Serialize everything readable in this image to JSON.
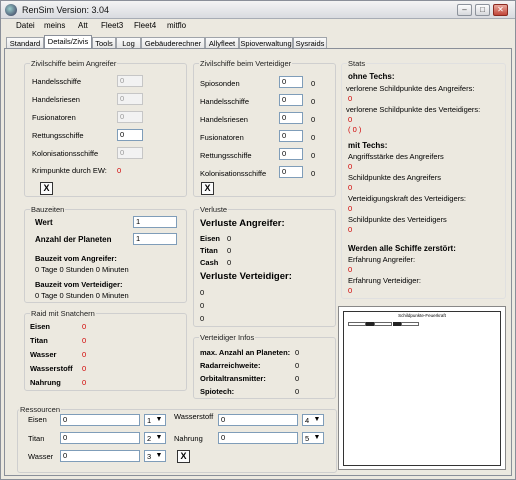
{
  "window": {
    "title": "RenSim Version: 3.04"
  },
  "menu": [
    "Datei",
    "meins",
    "Att",
    "Fleet3",
    "Fleet4",
    "mitflo"
  ],
  "tabs": [
    "Standard",
    "Details/Zivis",
    "Tools",
    "Log",
    "Gebäuderechner",
    "Allyfleet",
    "Spioverwaltung",
    "Sysraids"
  ],
  "attacker_civ": {
    "title": "Zivilschiffe beim Angreifer",
    "rows": [
      {
        "label": "Handelsschiffe",
        "value": "0"
      },
      {
        "label": "Handelsriesen",
        "value": "0"
      },
      {
        "label": "Fusionatoren",
        "value": "0"
      },
      {
        "label": "Rettungsschiffe",
        "value": "0"
      },
      {
        "label": "Kolonisationsschiffe",
        "value": "0"
      }
    ],
    "krimpunkte_label": "Krimpunkte durch EW:",
    "krimpunkte_value": "0",
    "x": "X"
  },
  "defender_civ": {
    "title": "Zivilschiffe beim Verteidiger",
    "rows": [
      {
        "label": "Spiosonden",
        "value": "0",
        "value2": "0"
      },
      {
        "label": "Handelsschiffe",
        "value": "0",
        "value2": "0"
      },
      {
        "label": "Handelsriesen",
        "value": "0",
        "value2": "0"
      },
      {
        "label": "Fusionatoren",
        "value": "0",
        "value2": "0"
      },
      {
        "label": "Rettungsschiffe",
        "value": "0",
        "value2": "0"
      },
      {
        "label": "Kolonisationsschiffe",
        "value": "0",
        "value2": "0"
      }
    ],
    "x": "X"
  },
  "bauzeiten": {
    "title": "Bauzeiten",
    "wert_label": "Wert",
    "wert_value": "1",
    "planeten_label": "Anzahl der Planeten",
    "planeten_value": "1",
    "ang_label": "Bauzeit vom Angreifer:",
    "ang_value": "0 Tage 0 Stunden 0 Minuten",
    "ver_label": "Bauzeit vom Verteidiger:",
    "ver_value": "0 Tage 0 Stunden 0 Minuten"
  },
  "verluste": {
    "title": "Verluste",
    "ang_heading": "Verluste Angreifer:",
    "rows": [
      {
        "label": "Eisen",
        "value": "0"
      },
      {
        "label": "Titan",
        "value": "0"
      },
      {
        "label": "Cash",
        "value": "0"
      }
    ],
    "ver_heading": "Verluste Verteidiger:",
    "ver_values": [
      "0",
      "0",
      "0"
    ]
  },
  "raid": {
    "title": "Raid mit Snatchern",
    "rows": [
      {
        "label": "Eisen",
        "value": "0"
      },
      {
        "label": "Titan",
        "value": "0"
      },
      {
        "label": "Wasser",
        "value": "0"
      },
      {
        "label": "Wasserstoff",
        "value": "0"
      },
      {
        "label": "Nahrung",
        "value": "0"
      }
    ]
  },
  "verteidiger_infos": {
    "title": "Verteidiger Infos",
    "rows": [
      {
        "label": "max. Anzahl an Planeten:",
        "value": "0"
      },
      {
        "label": "Radarreichweite:",
        "value": "0"
      },
      {
        "label": "Orbitaltransmitter:",
        "value": "0"
      },
      {
        "label": "Spiotech:",
        "value": "0"
      }
    ]
  },
  "stats": {
    "title": "Stats",
    "ohne_heading": "ohne Techs:",
    "ohne_rows": [
      {
        "label": "verlorene Schildpunkte des Angreifers:",
        "value": "0"
      },
      {
        "label": "verlorene Schildpunkte des Verteidigers:",
        "value": "0"
      }
    ],
    "ohne_extra": "( 0 )",
    "mit_heading": "mit Techs:",
    "mit_rows": [
      {
        "label": "Angriffsstärke des Angreifers",
        "value": "0"
      },
      {
        "label": "Schildpunkte des Angreifers",
        "value": "0"
      },
      {
        "label": "Verteidigungskraft des Verteidigers:",
        "value": "0"
      },
      {
        "label": "Schildpunkte des Verteidigers",
        "value": "0"
      }
    ],
    "zerstoert_heading": "Werden alle Schiffe zerstört:",
    "zerstoert_rows": [
      {
        "label": "Erfahrung Angreifer:",
        "value": "0"
      },
      {
        "label": "Erfahrung Verteidiger:",
        "value": "0"
      }
    ],
    "chart_title": "Schildpunkte-Feuerkraft"
  },
  "ressourcen": {
    "title": "Ressourcen",
    "left": [
      {
        "label": "Eisen",
        "value": "0",
        "combo": "1"
      },
      {
        "label": "Titan",
        "value": "0",
        "combo": "2"
      },
      {
        "label": "Wasser",
        "value": "0",
        "combo": "3"
      }
    ],
    "right": [
      {
        "label": "Wasserstoff",
        "value": "0",
        "combo": "4"
      },
      {
        "label": "Nahrung",
        "value": "0",
        "combo": "5"
      }
    ],
    "x": "X"
  },
  "colors": {
    "accent_red": "#d00000",
    "window_bg": "#ece9e0"
  }
}
